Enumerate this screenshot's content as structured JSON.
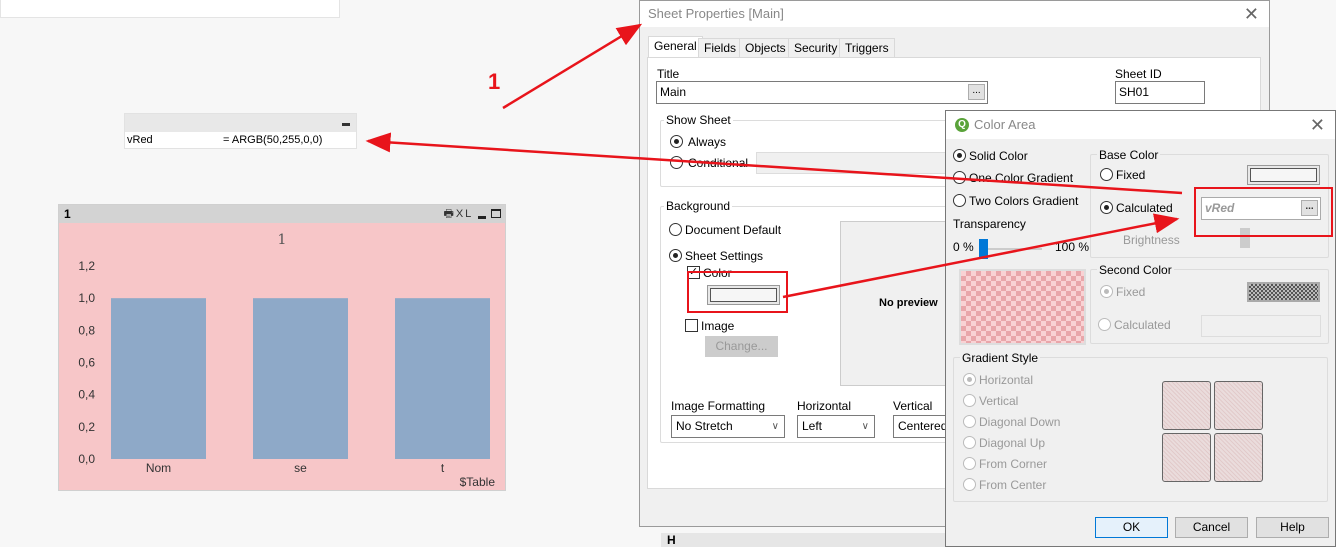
{
  "variable_box": {
    "name": "vRed",
    "definition": "= ARGB(50,255,0,0)"
  },
  "chart_object": {
    "caption": "1",
    "header_icons": [
      "print-icon",
      "excel-icon",
      "minimize-icon",
      "maximize-icon"
    ],
    "header_icon_text": "XL",
    "background_color": "#f7c6c8",
    "bar_color": "#8ea9c8"
  },
  "chart_data": {
    "type": "bar",
    "title": "1",
    "categories": [
      "Nom",
      "se",
      "t"
    ],
    "values": [
      1.0,
      1.0,
      1.0
    ],
    "xlabel": "$Table",
    "ylabel": "",
    "ylim": [
      0,
      1.2
    ],
    "yticks": [
      "0,0",
      "0,2",
      "0,4",
      "0,6",
      "0,8",
      "1,0",
      "1,2"
    ],
    "grid": false
  },
  "annotation": {
    "step_label": "1",
    "color": "#e8141b"
  },
  "sheet_properties": {
    "title": "Sheet Properties [Main]",
    "tabs": [
      "General",
      "Fields",
      "Objects",
      "Security",
      "Triggers"
    ],
    "active_tab": "General",
    "title_label": "Title",
    "title_value": "Main",
    "sheet_id_label": "Sheet ID",
    "sheet_id_value": "SH01",
    "show_sheet": {
      "label": "Show Sheet",
      "always": "Always",
      "conditional": "Conditional"
    },
    "background": {
      "label": "Background",
      "document_default": "Document Default",
      "sheet_settings": "Sheet Settings",
      "color": "Color",
      "image": "Image",
      "change": "Change...",
      "no_preview": "No preview",
      "image_formatting_label": "Image Formatting",
      "image_formatting_value": "No Stretch",
      "horizontal_label": "Horizontal",
      "horizontal_value": "Left",
      "vertical_label": "Vertical",
      "vertical_value": "Centered"
    },
    "bottom_object": "H"
  },
  "color_area": {
    "title": "Color Area",
    "solid_color": "Solid Color",
    "one_color_gradient": "One Color Gradient",
    "two_colors_gradient": "Two Colors Gradient",
    "transparency_label": "Transparency",
    "transparency_min": "0 %",
    "transparency_max": "100 %",
    "transparency_value": 0,
    "base_color": {
      "label": "Base Color",
      "fixed": "Fixed",
      "calculated": "Calculated",
      "calculated_value": "vRed",
      "brightness": "Brightness"
    },
    "second_color": {
      "label": "Second Color",
      "fixed": "Fixed",
      "calculated": "Calculated"
    },
    "gradient_style": {
      "label": "Gradient Style",
      "options": [
        "Horizontal",
        "Vertical",
        "Diagonal Down",
        "Diagonal Up",
        "From Corner",
        "From Center"
      ]
    },
    "buttons": {
      "ok": "OK",
      "cancel": "Cancel",
      "help": "Help"
    }
  }
}
